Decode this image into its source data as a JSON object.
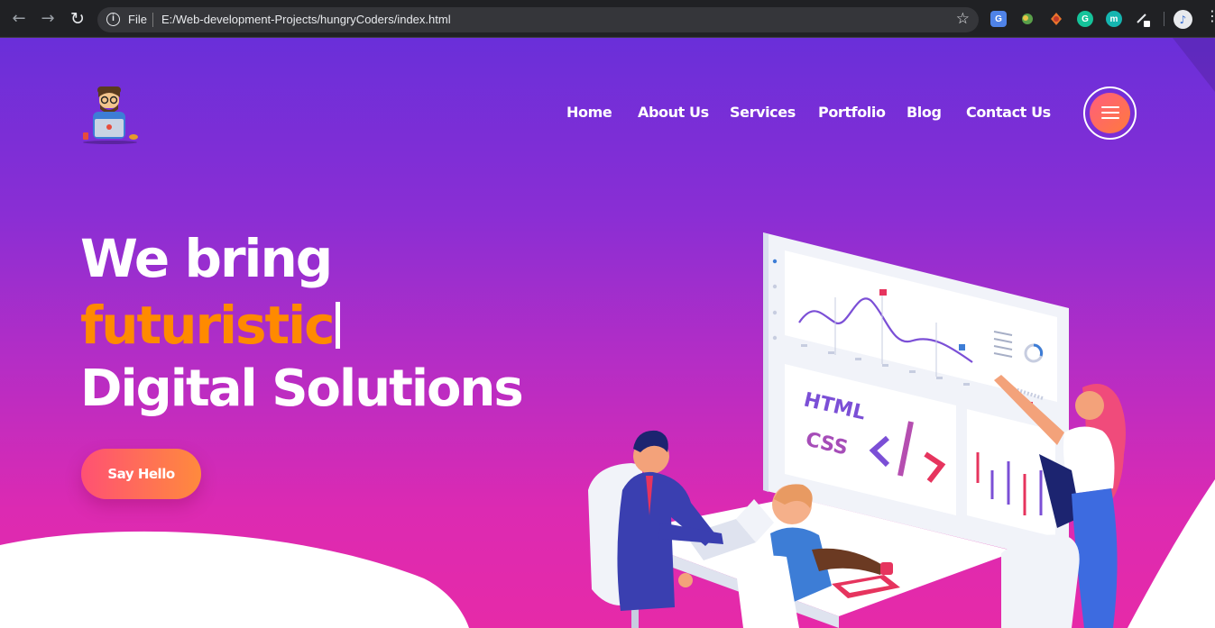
{
  "browser": {
    "scheme_label": "File",
    "url": "E:/Web-development-Projects/hungryCoders/index.html",
    "icons": [
      "back-arrow-icon",
      "forward-arrow-icon",
      "reload-icon",
      "info-icon",
      "star-icon",
      "google-translate-icon",
      "extension-icon",
      "extension-icon",
      "grammarly-icon",
      "extension-m-icon",
      "pen-icon",
      "profile-avatar",
      "kebab-menu-icon"
    ],
    "ext_letters": {
      "grammarly": "G",
      "m": "m"
    }
  },
  "nav": {
    "items": [
      {
        "label": "Home"
      },
      {
        "label": "About Us"
      },
      {
        "label": "Services"
      },
      {
        "label": "Portfolio"
      },
      {
        "label": "Blog"
      },
      {
        "label": "Contact Us"
      }
    ]
  },
  "hero": {
    "line1": "We bring",
    "line2": "futuristic",
    "line3": "Digital Solutions",
    "cta_label": "Say Hello"
  },
  "illustration": {
    "screen_text_1": "HTML",
    "screen_text_2": "CSS"
  },
  "colors": {
    "gradient_top": "#6a2fd9",
    "gradient_bottom": "#e62aa8",
    "accent_orange": "#ff8a00",
    "button_start": "#ff5173",
    "button_end": "#ff8a3d"
  }
}
